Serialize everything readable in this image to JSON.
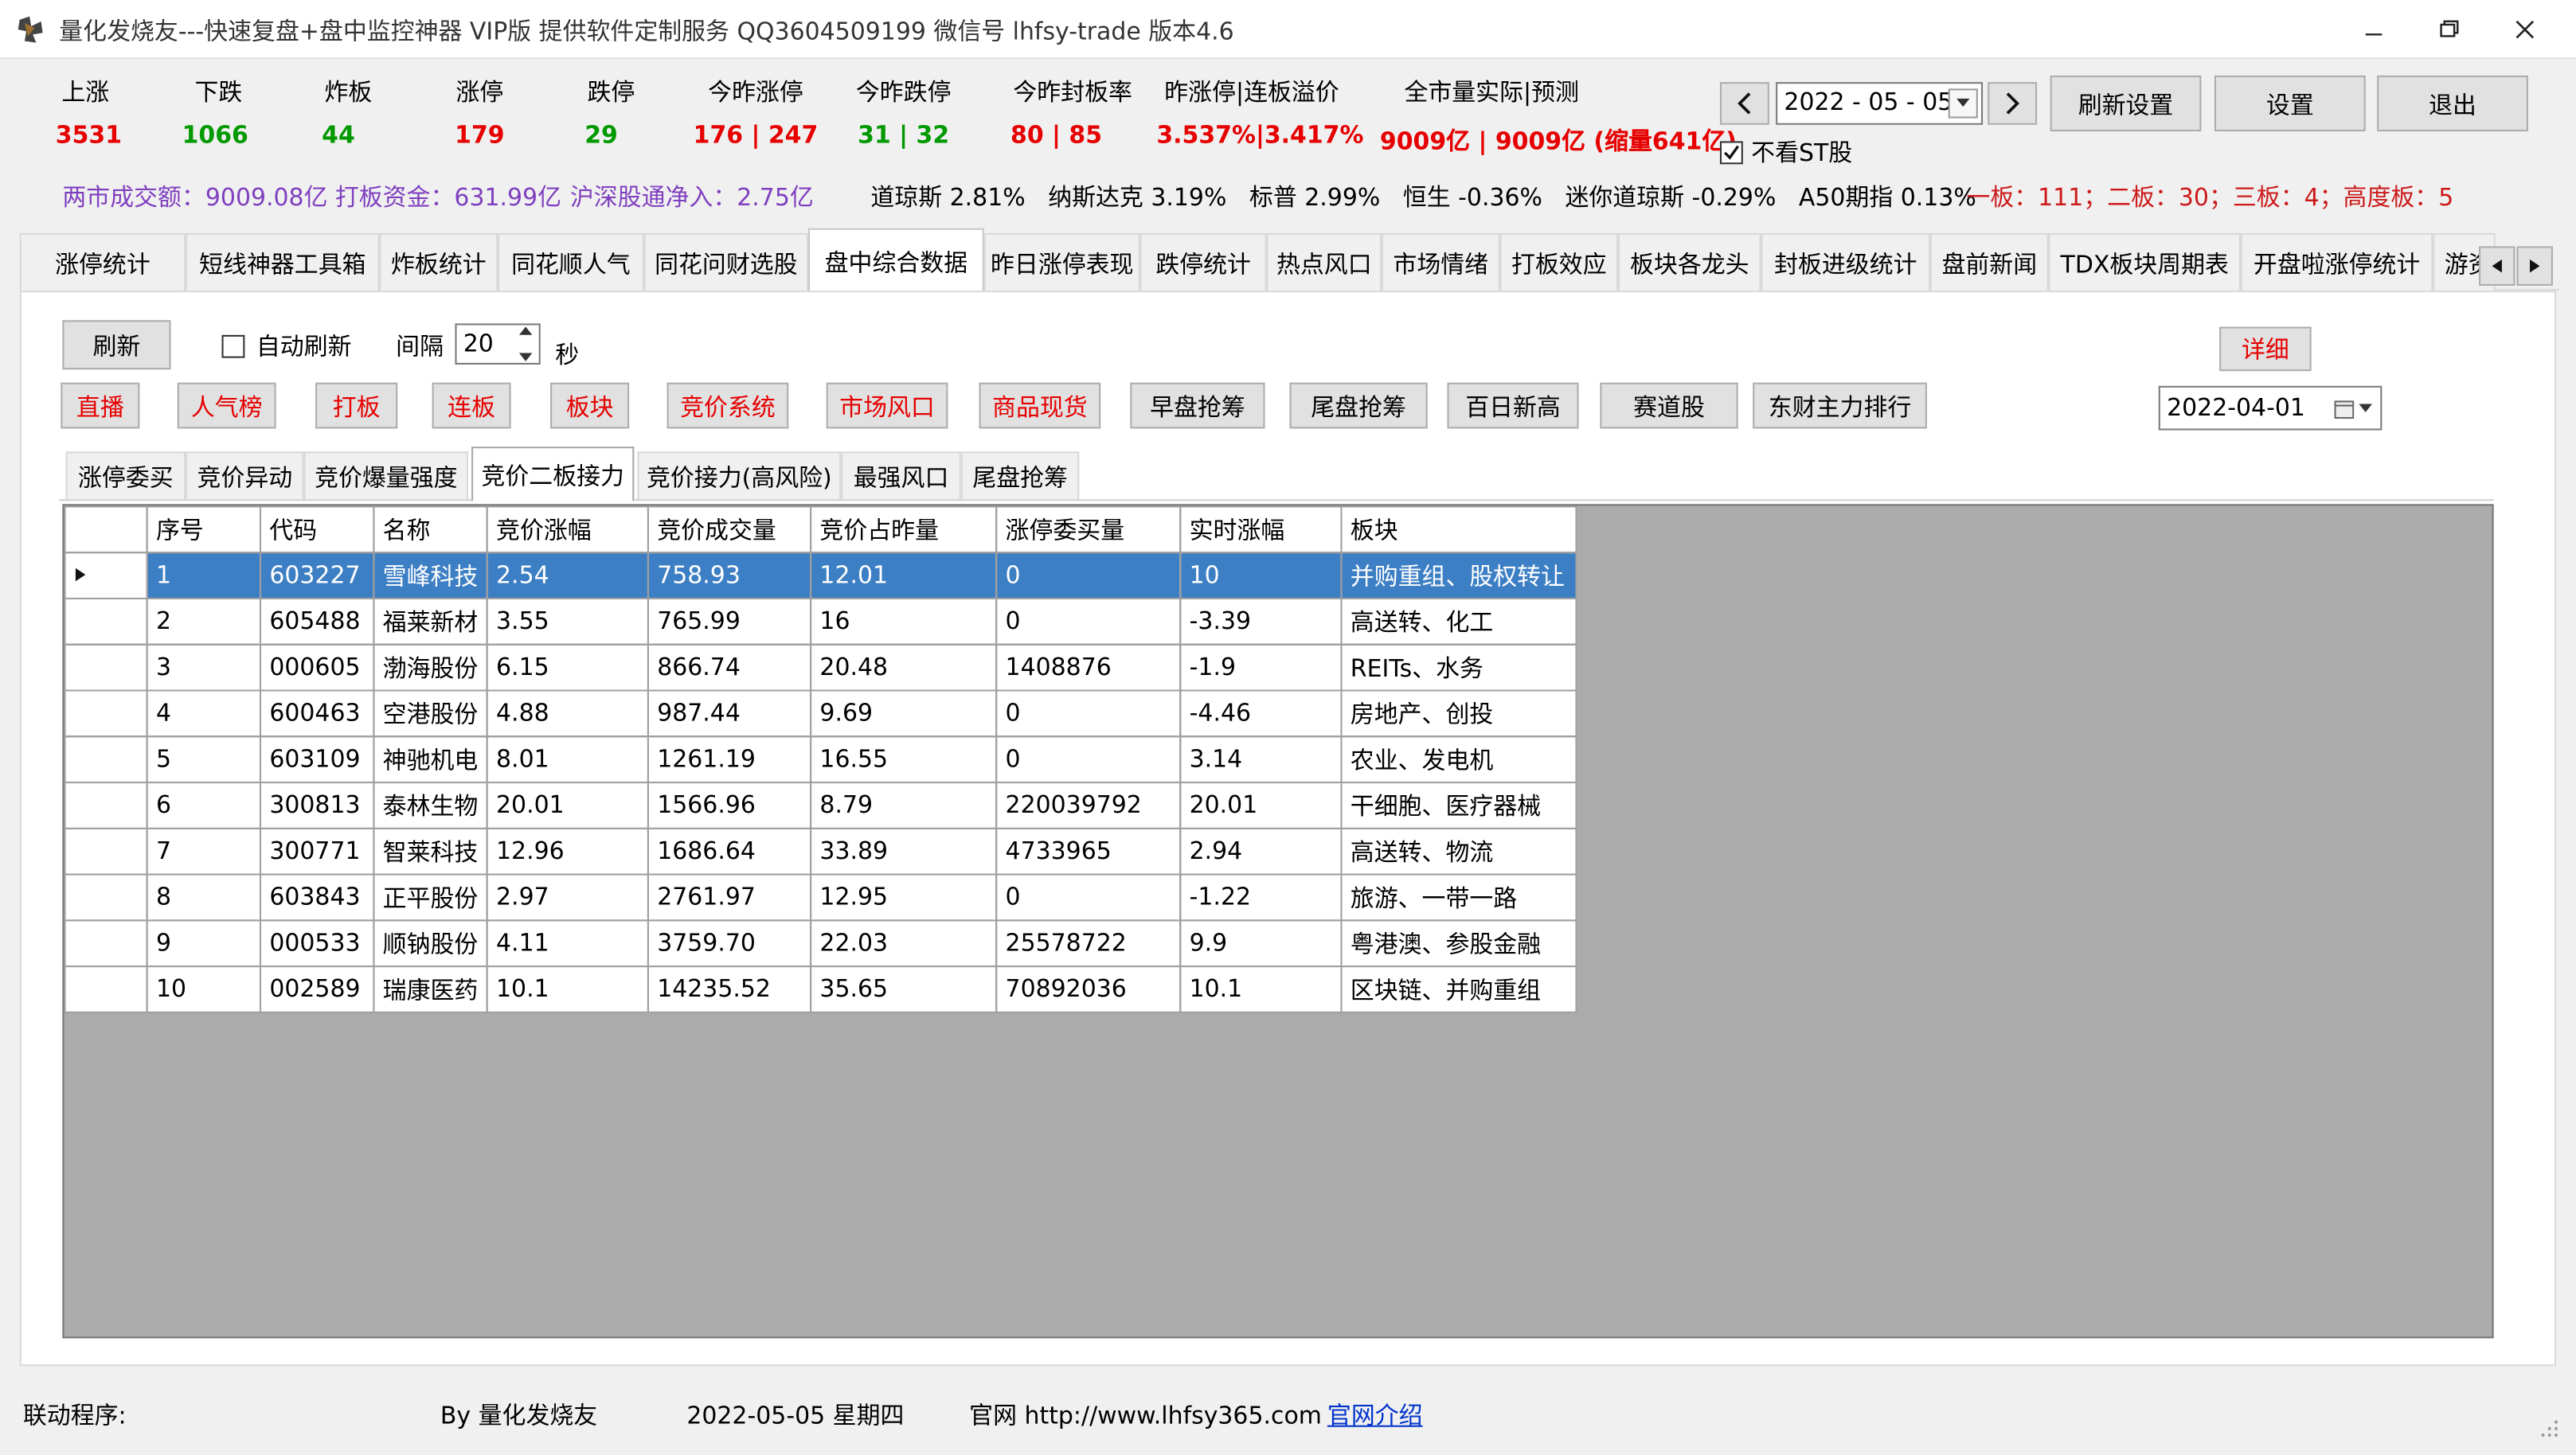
{
  "window": {
    "title": "量化发烧友---快速复盘+盘中监控神器 VIP版  提供软件定制服务 QQ3604509199 微信号 lhfsy-trade   版本4.6"
  },
  "stats": [
    {
      "label": "上涨",
      "value": "3531",
      "color": "#e60000"
    },
    {
      "label": "下跌",
      "value": "1066",
      "color": "#009900"
    },
    {
      "label": "炸板",
      "value": "44",
      "color": "#009900"
    },
    {
      "label": "涨停",
      "value": "179",
      "color": "#e60000"
    },
    {
      "label": "跌停",
      "value": "29",
      "color": "#009900"
    },
    {
      "label": "今昨涨停",
      "value": "176 | 247",
      "color": "#e60000"
    },
    {
      "label": "今昨跌停",
      "value": "31 | 32",
      "color": "#009900"
    },
    {
      "label": "今昨封板率",
      "value": "80 | 85",
      "color": "#e60000"
    },
    {
      "label": "昨涨停|连板溢价",
      "value": "3.537%|3.417%",
      "color": "#e60000"
    },
    {
      "label": "全市量实际|预测",
      "value": "9009亿 | 9009亿 (缩量641亿)",
      "color": "#e60000"
    }
  ],
  "date_nav": {
    "date": "2022 - 05 - 05",
    "prev": "<",
    "next": ">"
  },
  "buttons": {
    "refresh_settings": "刷新设置",
    "settings": "设置",
    "exit": "退出"
  },
  "no_st_label": "不看ST股",
  "info": {
    "turnover": "两市成交额：9009.08亿",
    "limit_funds": "打板资金：631.99亿",
    "northbound": "沪深股通净入：2.75亿",
    "indices": "道琼斯 2.81%   纳斯达克 3.19%   标普 2.99%   恒生 -0.36%   迷你道琼斯 -0.29%   A50期指 0.13%",
    "boards": "一板：111；二板：30；三板：4；高度板：5"
  },
  "main_tabs": [
    "涨停统计",
    "短线神器工具箱",
    "炸板统计",
    "同花顺人气",
    "同花问财选股",
    "盘中综合数据",
    "昨日涨停表现",
    "跌停统计",
    "热点风口",
    "市场情绪",
    "打板效应",
    "板块各龙头",
    "封板进级统计",
    "盘前新闻",
    "TDX板块周期表",
    "开盘啦涨停统计",
    "游资"
  ],
  "controls": {
    "refresh": "刷新",
    "auto_refresh": "自动刷新",
    "interval_label": "间隔",
    "interval_value": "20",
    "seconds_label": "秒",
    "detail": "详细",
    "side_date": "2022-04-01"
  },
  "red_buttons": [
    "直播",
    "人气榜",
    "打板",
    "连板",
    "板块",
    "竞价系统",
    "市场风口",
    "商品现货"
  ],
  "black_buttons": [
    "早盘抢筹",
    "尾盘抢筹",
    "百日新高",
    "赛道股",
    "东财主力排行"
  ],
  "sub_tabs": [
    "涨停委买",
    "竞价异动",
    "竞价爆量强度",
    "竞价二板接力",
    "竞价接力(高风险)",
    "最强风口",
    "尾盘抢筹"
  ],
  "table": {
    "columns": [
      "序号",
      "代码",
      "名称",
      "竞价涨幅",
      "竞价成交量",
      "竞价占昨量",
      "涨停委买量",
      "实时涨幅",
      "板块"
    ],
    "rows": [
      [
        "1",
        "603227",
        "雪峰科技",
        "2.54",
        "758.93",
        "12.01",
        "0",
        "10",
        "并购重组、股权转让"
      ],
      [
        "2",
        "605488",
        "福莱新材",
        "3.55",
        "765.99",
        "16",
        "0",
        "-3.39",
        "高送转、化工"
      ],
      [
        "3",
        "000605",
        "渤海股份",
        "6.15",
        "866.74",
        "20.48",
        "1408876",
        "-1.9",
        "REITs、水务"
      ],
      [
        "4",
        "600463",
        "空港股份",
        "4.88",
        "987.44",
        "9.69",
        "0",
        "-4.46",
        "房地产、创投"
      ],
      [
        "5",
        "603109",
        "神驰机电",
        "8.01",
        "1261.19",
        "16.55",
        "0",
        "3.14",
        "农业、发电机"
      ],
      [
        "6",
        "300813",
        "泰林生物",
        "20.01",
        "1566.96",
        "8.79",
        "220039792",
        "20.01",
        "干细胞、医疗器械"
      ],
      [
        "7",
        "300771",
        "智莱科技",
        "12.96",
        "1686.64",
        "33.89",
        "4733965",
        "2.94",
        "高送转、物流"
      ],
      [
        "8",
        "603843",
        "正平股份",
        "2.97",
        "2761.97",
        "12.95",
        "0",
        "-1.22",
        "旅游、一带一路"
      ],
      [
        "9",
        "000533",
        "顺钠股份",
        "4.11",
        "3759.70",
        "22.03",
        "25578722",
        "9.9",
        "粤港澳、参股金融"
      ],
      [
        "10",
        "002589",
        "瑞康医药",
        "10.1",
        "14235.52",
        "35.65",
        "70892036",
        "10.1",
        "区块链、并购重组"
      ]
    ]
  },
  "status": {
    "linked": "联动程序:",
    "author": "By 量化发烧友",
    "date": "2022-05-05 星期四",
    "site": "官网 http://www.lhfsy365.com",
    "site_link": "官网介绍"
  }
}
